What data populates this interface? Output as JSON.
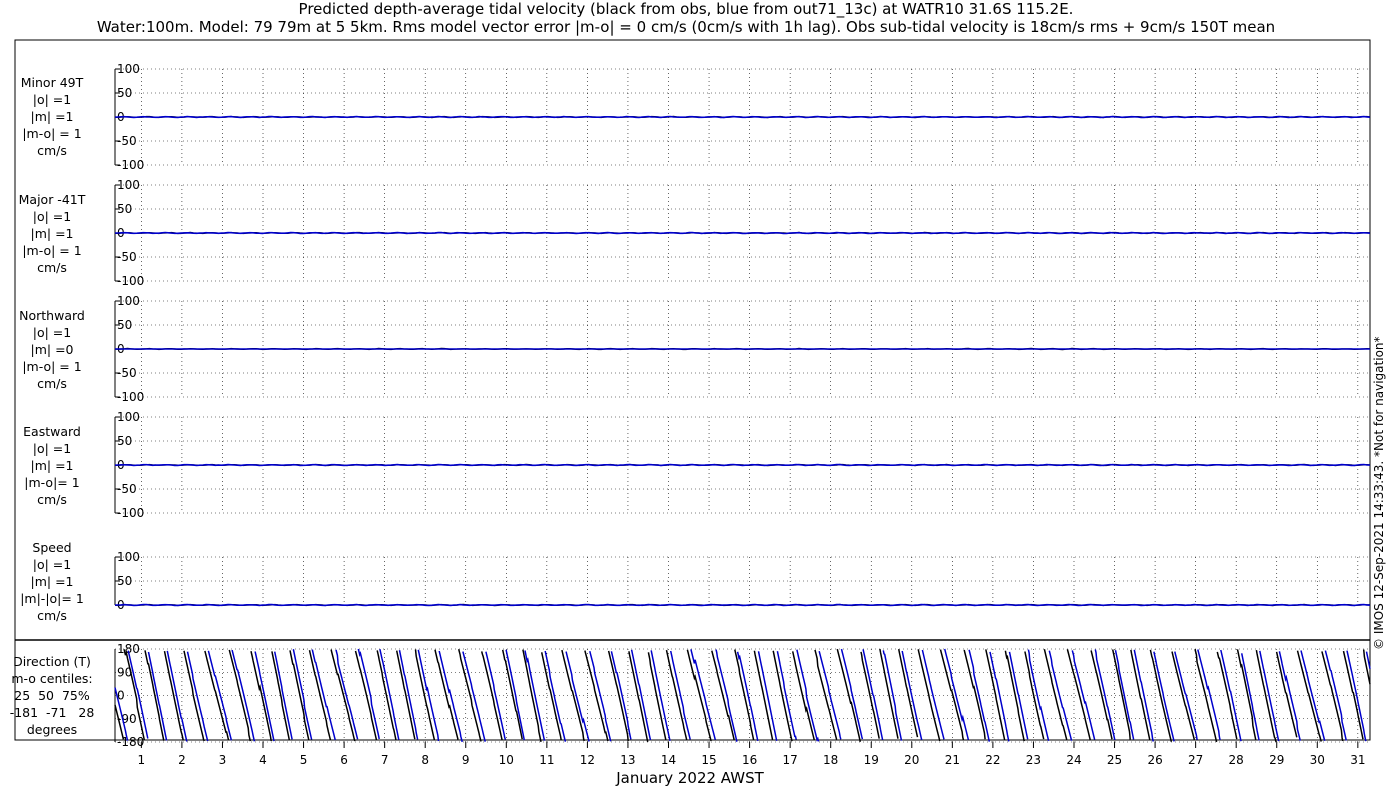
{
  "title_line1": "Predicted depth-average tidal velocity (black from obs, blue from out71_13c) at WATR10 31.6S 115.2E.",
  "title_line2": "Water:100m. Model: 79 79m at 5 5km. Rms model vector error |m-o| = 0 cm/s (0cm/s with 1h lag). Obs sub-tidal velocity is 18cm/s rms + 9cm/s 150T mean",
  "credit": "© IMOS 12-Sep-2021 14:33:43. *Not for navigation*",
  "colors": {
    "obs": "#000000",
    "model": "#0000cc"
  },
  "chart_data": {
    "type": "line",
    "xlabel": "January 2022 AWST",
    "x_ticks": [
      1,
      2,
      3,
      4,
      5,
      6,
      7,
      8,
      9,
      10,
      11,
      12,
      13,
      14,
      15,
      16,
      17,
      18,
      19,
      20,
      21,
      22,
      23,
      24,
      25,
      26,
      27,
      28,
      29,
      30,
      31
    ],
    "xlim": [
      0.35,
      31.3
    ],
    "grid": "dotted",
    "series_names": [
      "obs",
      "out71_13c"
    ],
    "panels": [
      {
        "label": "Minor 49T\n|o| =1\n|m| =1\n|m-o| = 1\ncm/s",
        "ylim": [
          -100,
          100
        ],
        "yticks": [
          "100",
          "50",
          "0",
          "-50",
          "-100"
        ],
        "ytick_values": [
          100,
          50,
          0,
          -50,
          -100
        ],
        "series": [
          {
            "name": "obs",
            "approx_value": 0,
            "amplitude": 1
          },
          {
            "name": "model",
            "approx_value": 0,
            "amplitude": 1
          }
        ]
      },
      {
        "label": "Major -41T\n|o| =1\n|m| =1\n|m-o| = 1\ncm/s",
        "ylim": [
          -100,
          100
        ],
        "yticks": [
          "100",
          "50",
          "0",
          "-50",
          "-100"
        ],
        "ytick_values": [
          100,
          50,
          0,
          -50,
          -100
        ],
        "series": [
          {
            "name": "obs",
            "approx_value": 0,
            "amplitude": 1
          },
          {
            "name": "model",
            "approx_value": 0,
            "amplitude": 1
          }
        ]
      },
      {
        "label": "Northward\n|o| =1\n|m| =0\n|m-o| = 1\ncm/s",
        "ylim": [
          -100,
          100
        ],
        "yticks": [
          "100",
          "50",
          "0",
          "-50",
          "-100"
        ],
        "ytick_values": [
          100,
          50,
          0,
          -50,
          -100
        ],
        "series": [
          {
            "name": "obs",
            "approx_value": 0,
            "amplitude": 1
          },
          {
            "name": "model",
            "approx_value": 0,
            "amplitude": 0
          }
        ]
      },
      {
        "label": "Eastward\n|o| =1\n|m| =1\n|m-o|= 1\ncm/s",
        "ylim": [
          -100,
          100
        ],
        "yticks": [
          "100",
          "50",
          "0",
          "-50",
          "-100"
        ],
        "ytick_values": [
          100,
          50,
          0,
          -50,
          -100
        ],
        "series": [
          {
            "name": "obs",
            "approx_value": 0,
            "amplitude": 1
          },
          {
            "name": "model",
            "approx_value": 0,
            "amplitude": 1
          }
        ]
      },
      {
        "label": "Speed\n|o| =1\n|m| =1\n|m|-|o|= 1\ncm/s",
        "ylim": [
          0,
          100
        ],
        "yticks": [
          "100",
          "50",
          "0"
        ],
        "ytick_values": [
          100,
          50,
          0
        ],
        "series": [
          {
            "name": "obs",
            "approx_value": 0,
            "amplitude": 1
          },
          {
            "name": "model",
            "approx_value": 0,
            "amplitude": 1
          }
        ]
      }
    ],
    "direction_panel": {
      "label": "Direction (T)\nm-o centiles:\n25  50  75%\n-181  -71   28\ndegrees",
      "ylim": [
        -180,
        180
      ],
      "yticks": [
        "180",
        "90",
        "0",
        "-90",
        "-180"
      ],
      "ytick_values": [
        180,
        90,
        0,
        -90,
        -180
      ],
      "series": [
        "obs",
        "model"
      ],
      "pattern": "sawtooth wrapping between -180 and 180, roughly two cycles per day"
    }
  }
}
